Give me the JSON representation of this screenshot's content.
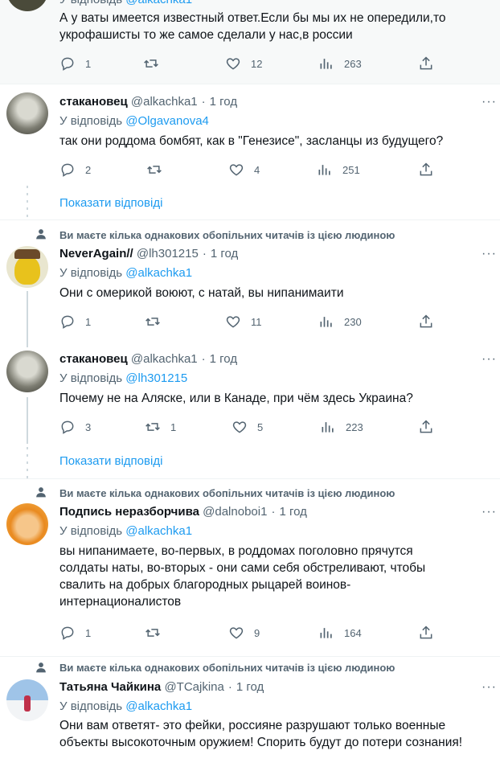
{
  "tweets": [
    {
      "reply_to_prefix": "У відповідь",
      "reply_to": "@alkachka1",
      "text": "А у ваты имеется известный ответ.Если бы мы их не опередили,то укрофашисты то же самое сделали у нас,в россии",
      "replies": "1",
      "retweets": "",
      "likes": "12",
      "views": "263"
    },
    {
      "name": "стакановец",
      "handle": "@alkachka1",
      "time": "1 год",
      "reply_to_prefix": "У відповідь",
      "reply_to": "@Olgavanova4",
      "text": "так они роддома бомбят, как в \"Генезисе\", засланцы из будущего?",
      "replies": "2",
      "retweets": "",
      "likes": "4",
      "views": "251",
      "show_replies": "Показати відповіді"
    },
    {
      "social": "Ви маєте кілька однакових обопільних читачів із цією людиною",
      "name": "NeverAgain//",
      "handle": "@lh301215",
      "time": "1 год",
      "reply_to_prefix": "У відповідь",
      "reply_to": "@alkachka1",
      "text": "Они с омерикой воюют, с натай, вы нипанимаити",
      "replies": "1",
      "retweets": "",
      "likes": "11",
      "views": "230"
    },
    {
      "name": "стакановец",
      "handle": "@alkachka1",
      "time": "1 год",
      "reply_to_prefix": "У відповідь",
      "reply_to": "@lh301215",
      "text": "Почему не на Аляске, или в Канаде, при чём здесь Украина?",
      "replies": "3",
      "retweets": "1",
      "likes": "5",
      "views": "223",
      "show_replies": "Показати відповіді"
    },
    {
      "social": "Ви маєте кілька однакових обопільних читачів із цією людиною",
      "name": "Подпись неразборчива",
      "handle": "@dalnoboi1",
      "time": "1 год",
      "reply_to_prefix": "У відповідь",
      "reply_to": "@alkachka1",
      "text": "вы нипанимаете, во-первых, в роддомах поголовно прячутся солдаты наты, во-вторых - они сами себя обстреливают, чтобы свалить на добрых благородных рыцарей воинов-интернационалистов",
      "replies": "1",
      "retweets": "",
      "likes": "9",
      "views": "164"
    },
    {
      "social": "Ви маєте кілька однакових обопільних читачів із цією людиною",
      "name": "Татьяна Чайкина",
      "handle": "@TCajkina",
      "time": "1 год",
      "reply_to_prefix": "У відповідь",
      "reply_to": "@alkachka1",
      "text": "Они вам ответят- это фейки, россияне разрушают только военные объекты высокоточным оружием! Спорить будут до потери сознания!"
    }
  ],
  "colors": {
    "link": "#1d9bf0",
    "muted": "#536471",
    "text": "#0f1419"
  }
}
